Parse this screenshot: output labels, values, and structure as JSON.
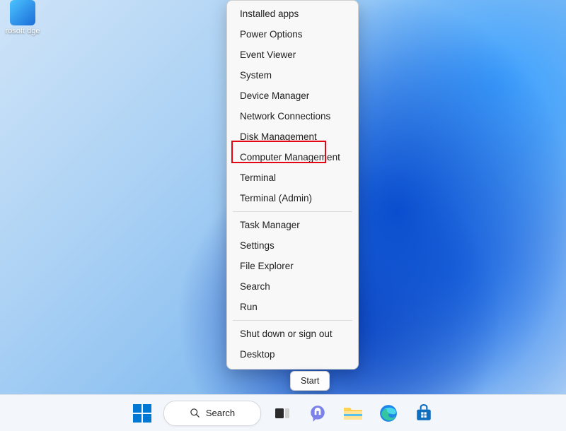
{
  "desktop_icon": {
    "label": "rosoft\ndge"
  },
  "winx_menu": {
    "items": [
      "Installed apps",
      "Power Options",
      "Event Viewer",
      "System",
      "Device Manager",
      "Network Connections",
      "Disk Management",
      "Computer Management",
      "Terminal",
      "Terminal (Admin)",
      "Task Manager",
      "Settings",
      "File Explorer",
      "Search",
      "Run",
      "Shut down or sign out",
      "Desktop"
    ],
    "highlighted_index": 6,
    "separators_after": [
      9,
      14
    ]
  },
  "tooltip": {
    "label": "Start"
  },
  "taskbar": {
    "search_label": "Search",
    "pinned": [
      {
        "name": "start",
        "highlight": true
      },
      {
        "name": "search",
        "highlight": false
      },
      {
        "name": "task-view",
        "highlight": false
      },
      {
        "name": "chat",
        "highlight": false
      },
      {
        "name": "file-explorer",
        "highlight": false
      },
      {
        "name": "edge",
        "highlight": false
      },
      {
        "name": "store",
        "highlight": false
      }
    ]
  },
  "colors": {
    "highlight": "#e30613",
    "accent": "#0078d4"
  }
}
